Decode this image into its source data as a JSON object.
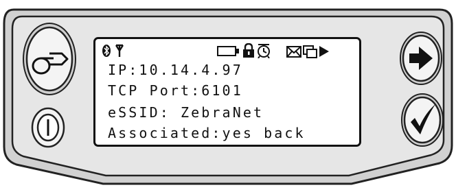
{
  "display": {
    "lines": [
      "IP:10.14.4.97",
      "TCP Port:6101",
      "eSSID: ZebraNet",
      "Associated:yes back"
    ],
    "status_icons": [
      "bluetooth-icon",
      "antenna-icon",
      "battery-icon",
      "lock-icon",
      "alarm-clock-icon",
      "envelope-icon",
      "data-icon",
      "play-arrow-icon"
    ]
  },
  "buttons": {
    "left_top": "feed-icon",
    "left_bottom": "power-icon",
    "right_top": "next-arrow-icon",
    "right_bottom": "checkmark-icon"
  },
  "colors": {
    "panel_outer": "#d1d1d1",
    "panel_inner": "#e6e6e6",
    "outline": "#222222",
    "lcd": "#ffffff"
  }
}
